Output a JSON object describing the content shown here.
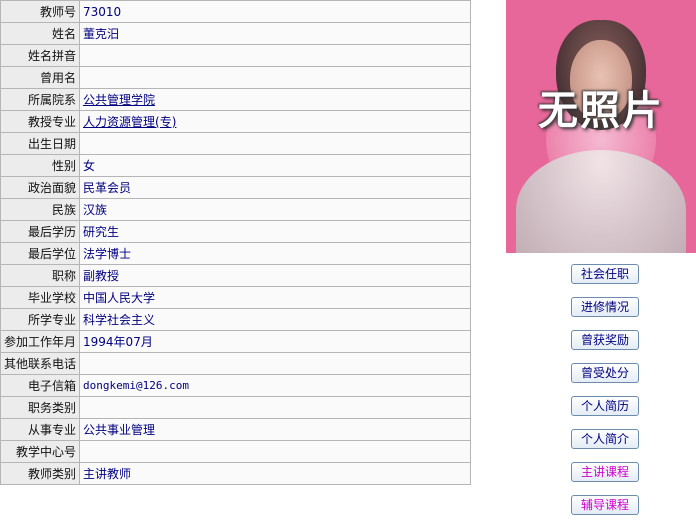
{
  "profile": {
    "rows": [
      {
        "label": "教师号",
        "value": "73010"
      },
      {
        "label": "姓名",
        "value": "董克汨"
      },
      {
        "label": "姓名拼音",
        "value": ""
      },
      {
        "label": "曾用名",
        "value": ""
      },
      {
        "label": "所属院系",
        "value": "公共管理学院",
        "link": true
      },
      {
        "label": "教授专业",
        "value": "人力资源管理(专)",
        "link": true
      },
      {
        "label": "出生日期",
        "value": ""
      },
      {
        "label": "性别",
        "value": "女"
      },
      {
        "label": "政治面貌",
        "value": "民革会员"
      },
      {
        "label": "民族",
        "value": "汉族"
      },
      {
        "label": "最后学历",
        "value": "研究生"
      },
      {
        "label": "最后学位",
        "value": "法学博士"
      },
      {
        "label": "职称",
        "value": "副教授"
      },
      {
        "label": "毕业学校",
        "value": "中国人民大学"
      },
      {
        "label": "所学专业",
        "value": "科学社会主义"
      },
      {
        "label": "参加工作年月",
        "value": "1994年07月"
      },
      {
        "label": "其他联系电话",
        "value": ""
      },
      {
        "label": "电子信箱",
        "value": "dongkemi@126.com",
        "mono": true
      },
      {
        "label": "职务类别",
        "value": ""
      },
      {
        "label": "从事专业",
        "value": "公共事业管理"
      },
      {
        "label": "教学中心号",
        "value": ""
      },
      {
        "label": "教师类别",
        "value": "主讲教师"
      }
    ]
  },
  "photo": {
    "caption": "无照片"
  },
  "buttons": [
    {
      "label": "社会任职",
      "color": "#000080"
    },
    {
      "label": "进修情况",
      "color": "#000080"
    },
    {
      "label": "曾获奖励",
      "color": "#000080"
    },
    {
      "label": "曾受处分",
      "color": "#000080"
    },
    {
      "label": "个人简历",
      "color": "#000080"
    },
    {
      "label": "个人简介",
      "color": "#000080"
    },
    {
      "label": "主讲课程",
      "color": "#cc00cc"
    },
    {
      "label": "辅导课程",
      "color": "#cc00cc"
    }
  ]
}
